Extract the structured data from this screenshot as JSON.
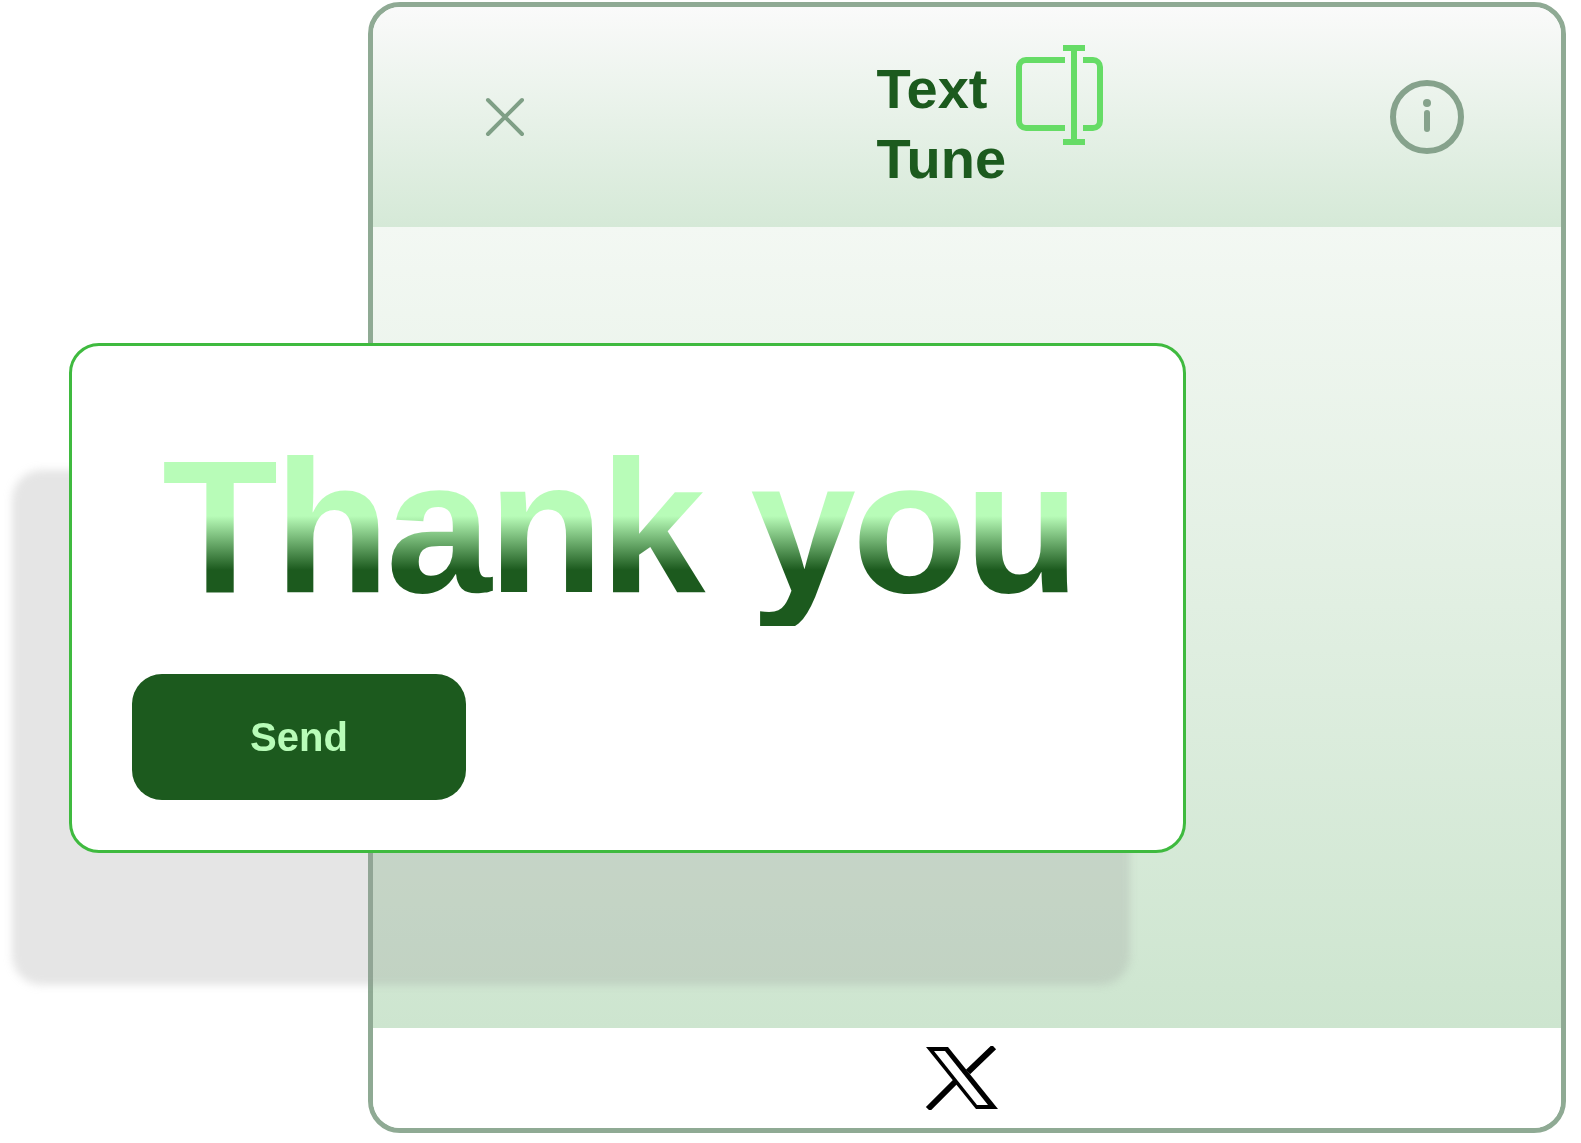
{
  "header": {
    "logo_lines": [
      "Text",
      "Tune"
    ]
  },
  "dialog": {
    "heading": "Thank you",
    "button": "Send"
  }
}
